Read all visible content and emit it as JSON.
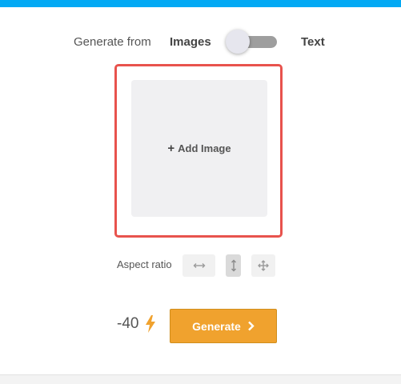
{
  "generate_from": {
    "label": "Generate from",
    "option_images": "Images",
    "option_text": "Text",
    "selected": "Images"
  },
  "upload": {
    "add_image_label": "Add Image",
    "plus_icon": "plus-icon"
  },
  "aspect_ratio": {
    "label": "Aspect ratio",
    "options": [
      {
        "icon": "landscape-arrows-icon",
        "active": false
      },
      {
        "icon": "portrait-arrows-icon",
        "active": true
      },
      {
        "icon": "free-arrows-icon",
        "active": false
      }
    ]
  },
  "cost": {
    "value": "-40",
    "icon": "lightning-bolt-icon",
    "icon_color": "#f0a22e"
  },
  "generate_button": {
    "label": "Generate",
    "icon": "chevron-right-icon",
    "color": "#f0a22e"
  },
  "colors": {
    "top_bar": "#03a9f4",
    "highlight_border": "#e8534d"
  }
}
